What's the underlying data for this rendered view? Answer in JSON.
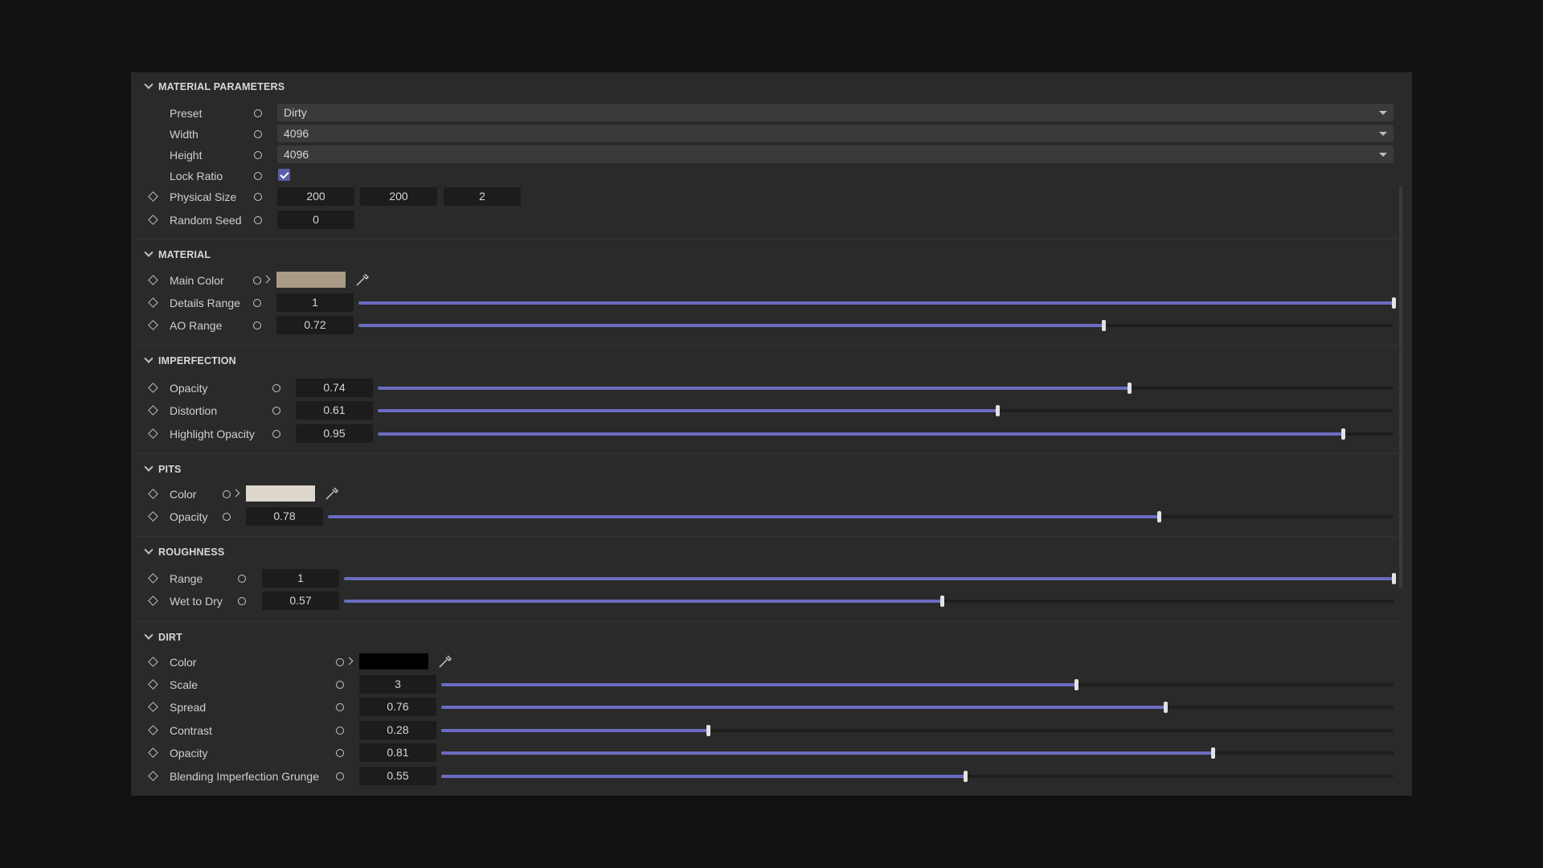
{
  "sections": {
    "material_parameters": {
      "title": "MATERIAL PARAMETERS",
      "preset": {
        "label": "Preset",
        "value": "Dirty"
      },
      "width": {
        "label": "Width",
        "value": "4096"
      },
      "height": {
        "label": "Height",
        "value": "4096"
      },
      "lock_ratio": {
        "label": "Lock Ratio",
        "checked": true
      },
      "physical_size": {
        "label": "Physical Size",
        "x": "200",
        "y": "200",
        "z": "2"
      },
      "random_seed": {
        "label": "Random Seed",
        "value": "0"
      }
    },
    "material": {
      "title": "MATERIAL",
      "main_color": {
        "label": "Main Color",
        "color": "#a99b86"
      },
      "details_range": {
        "label": "Details Range",
        "value": "1",
        "fraction": 1.0
      },
      "ao_range": {
        "label": "AO Range",
        "value": "0.72",
        "fraction": 0.72
      }
    },
    "imperfection": {
      "title": "IMPERFECTION",
      "opacity": {
        "label": "Opacity",
        "value": "0.74",
        "fraction": 0.74
      },
      "distortion": {
        "label": "Distortion",
        "value": "0.61",
        "fraction": 0.61
      },
      "highlight_opacity": {
        "label": "Highlight Opacity",
        "value": "0.95",
        "fraction": 0.95
      }
    },
    "pits": {
      "title": "PITS",
      "color": {
        "label": "Color",
        "color": "#ddd6cc"
      },
      "opacity": {
        "label": "Opacity",
        "value": "0.78",
        "fraction": 0.78
      }
    },
    "roughness": {
      "title": "ROUGHNESS",
      "range": {
        "label": "Range",
        "value": "1",
        "fraction": 1.0
      },
      "wet_to_dry": {
        "label": "Wet to Dry",
        "value": "0.57",
        "fraction": 0.57
      }
    },
    "dirt": {
      "title": "DIRT",
      "color": {
        "label": "Color",
        "color": "#000000"
      },
      "scale": {
        "label": "Scale",
        "value": "3",
        "fraction": 0.667
      },
      "spread": {
        "label": "Spread",
        "value": "0.76",
        "fraction": 0.76
      },
      "contrast": {
        "label": "Contrast",
        "value": "0.28",
        "fraction": 0.28
      },
      "opacity": {
        "label": "Opacity",
        "value": "0.81",
        "fraction": 0.81
      },
      "blending": {
        "label": "Blending Imperfection Grunge",
        "value": "0.55",
        "fraction": 0.55
      }
    }
  },
  "colors": {
    "accent": "#6a6cc0",
    "panel": "#2a2a2a",
    "background": "#121212"
  },
  "icons": {
    "keyframe": "diamond-icon",
    "link": "circle-icon",
    "expand": "chevron-right-icon",
    "section": "chevron-down-icon",
    "picker": "eyedropper-icon"
  }
}
